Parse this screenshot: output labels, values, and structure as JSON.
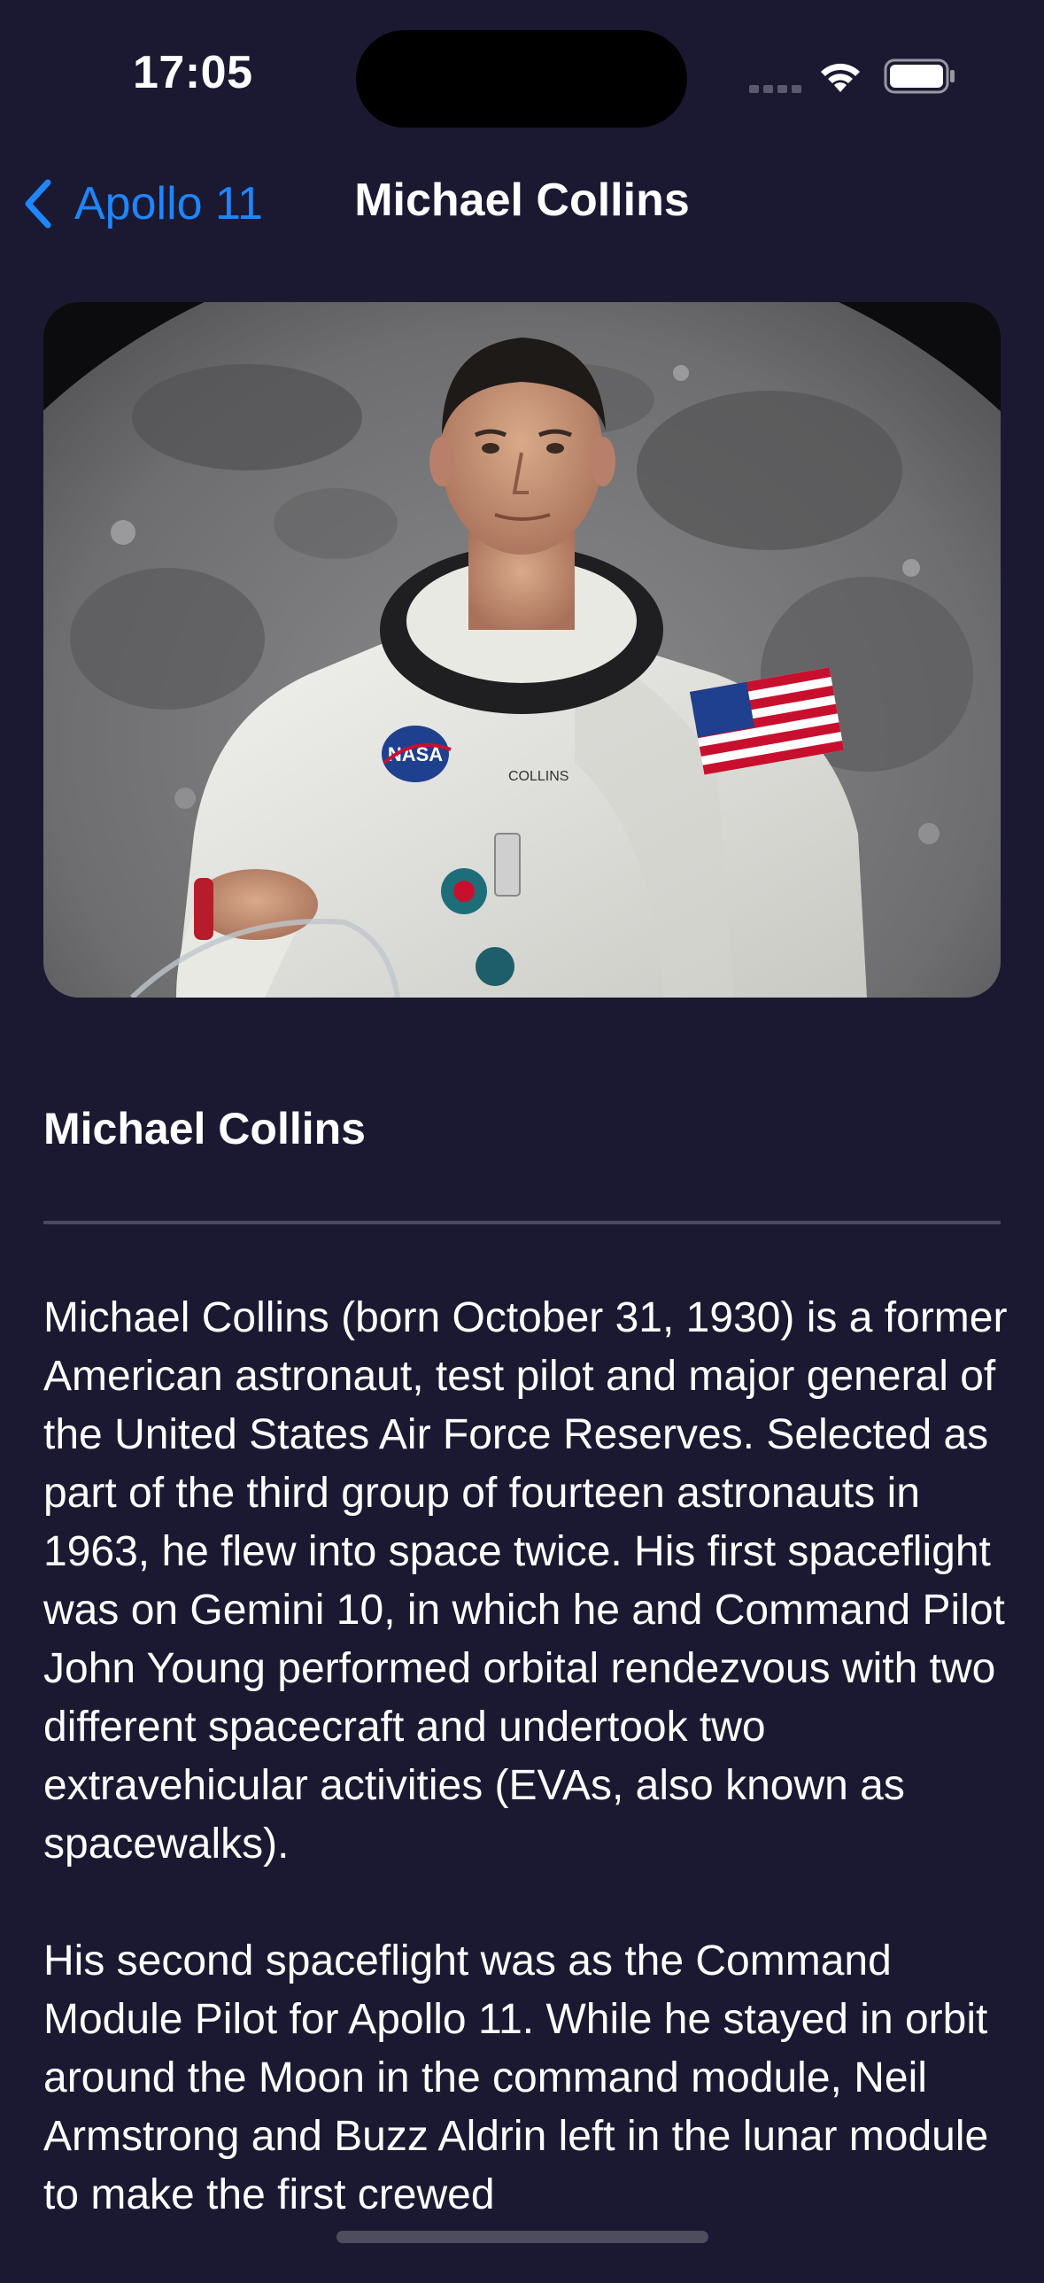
{
  "status_bar": {
    "time": "17:05",
    "icons": [
      "cellular-signal-icon",
      "wifi-icon",
      "battery-icon"
    ]
  },
  "nav": {
    "back_label": "Apollo 11",
    "back_icon": "chevron-left-icon",
    "title": "Michael Collins"
  },
  "hero": {
    "image": "astronaut-portrait",
    "suit_name_tag": "COLLINS",
    "patch_text": "NASA"
  },
  "content": {
    "heading": "Michael Collins",
    "paragraphs": [
      "Michael Collins (born October 31, 1930) is a former American astronaut, test pilot and major general of the United States Air Force Reserves. Selected as part of the third group of fourteen astronauts in 1963, he flew into space twice. His first spaceflight was on Gemini 10, in which he and Command Pilot John Young performed orbital rendezvous with two different spacecraft and undertook two extravehicular activities (EVAs, also known as spacewalks).",
      "His second spaceflight was as the Command Module Pilot for Apollo 11. While he stayed in orbit around the Moon in the command module, Neil Armstrong and Buzz Aldrin left in the lunar module to make the first crewed"
    ]
  },
  "colors": {
    "background": "#1b1932",
    "accent": "#1e86ff",
    "text": "#ffffff",
    "divider": "#4a4960"
  }
}
